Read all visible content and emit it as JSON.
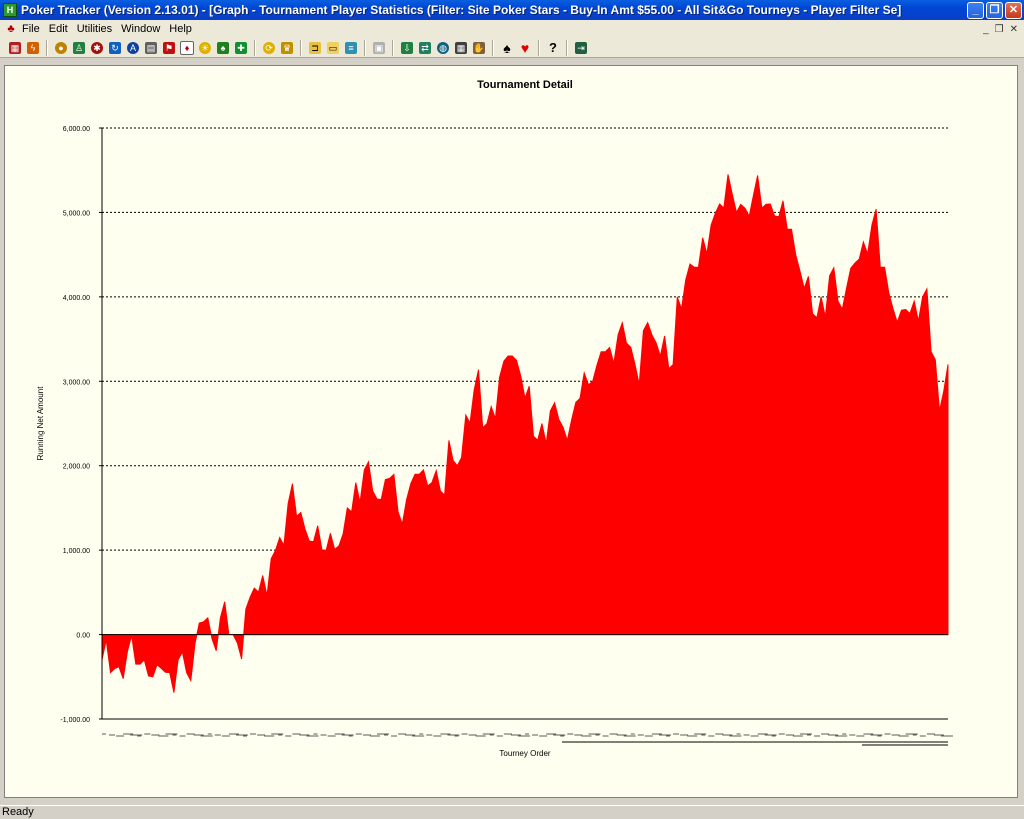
{
  "window": {
    "title": "Poker Tracker (Version 2.13.01) - [Graph - Tournament Player Statistics (Filter: Site Poker Stars - Buy-In Amt $55.00 - All Sit&Go Tourneys - Player Filter Se]"
  },
  "menu": {
    "items": [
      {
        "label": "File"
      },
      {
        "label": "Edit"
      },
      {
        "label": "Utilities"
      },
      {
        "label": "Window"
      },
      {
        "label": "Help"
      }
    ]
  },
  "toolbar": {
    "icons": [
      "graph-icon",
      "lightning-icon",
      "chip-icon",
      "player-icon",
      "gear-red-icon",
      "recycle-icon",
      "blue-a-icon",
      "stats-icon",
      "flag-icon",
      "card-icon",
      "sun-chip-icon",
      "spade-chip-icon",
      "green-chip-icon",
      "refresh-icon",
      "trophy-icon",
      "open-folder-icon",
      "folder-icon",
      "stack-icon",
      "save-icon",
      "import-icon",
      "sync-icon",
      "globe-icon",
      "grid-icon",
      "hand-icon",
      "spade-icon",
      "heart-icon",
      "help-icon",
      "exit-icon"
    ]
  },
  "status": {
    "text": "Ready"
  },
  "chart_data": {
    "type": "area",
    "title": "Tournament Detail",
    "xlabel": "Tourney Order",
    "ylabel": "Running Net Amount",
    "ylim": [
      -1000,
      6000
    ],
    "yticks": [
      "-1,000.00",
      "0.00",
      "1,000.00",
      "2,000.00",
      "3,000.00",
      "4,000.00",
      "5,000.00",
      "6,000.00"
    ],
    "grid": true,
    "fill_color": "#ff0000",
    "series": [
      {
        "x": [
          0,
          5,
          10,
          15,
          20,
          25,
          30,
          35,
          40,
          45,
          50,
          55,
          60,
          65,
          70,
          75,
          80,
          85,
          90,
          95,
          100,
          105,
          110,
          115,
          120,
          125,
          130,
          135,
          140,
          145,
          150,
          155,
          160,
          165,
          170,
          175,
          180,
          185,
          190,
          195,
          200,
          205,
          210,
          215,
          220,
          225,
          230,
          235,
          240,
          245,
          250,
          255,
          260,
          265,
          270,
          275,
          280,
          285,
          290,
          295,
          300,
          305,
          310,
          315,
          320,
          325,
          330,
          335,
          340,
          345,
          350,
          355,
          360,
          365,
          370,
          375,
          380,
          385,
          390,
          395,
          400,
          405,
          410,
          415,
          420,
          425,
          430,
          435,
          440,
          445,
          450,
          455,
          460,
          465,
          470,
          475,
          480,
          485,
          490,
          495,
          500
        ],
        "values": [
          -300,
          -450,
          -380,
          -200,
          -350,
          -300,
          -500,
          -400,
          -450,
          -300,
          -450,
          -100,
          150,
          -50,
          200,
          0,
          -100,
          300,
          550,
          700,
          900,
          1150,
          1550,
          1400,
          1250,
          1100,
          1000,
          1200,
          1050,
          1500,
          1800,
          1950,
          1700,
          1600,
          1850,
          1450,
          1600,
          1900,
          1950,
          1800,
          1700,
          2300,
          2000,
          2600,
          2900,
          2450,
          2700,
          3050,
          3300,
          3250,
          2800,
          2350,
          2500,
          2650,
          2550,
          2300,
          2750,
          3100,
          3000,
          3350,
          3400,
          3550,
          3450,
          3200,
          3600,
          3550,
          3300,
          3150,
          4000,
          4200,
          4350,
          4700,
          4850,
          5100,
          5450,
          5000,
          5050,
          5200,
          5050,
          5100,
          4950,
          4800,
          4500,
          4100,
          3800,
          4000,
          4250,
          3950,
          4100,
          4400,
          4650,
          4850,
          4350,
          4050,
          3700,
          3850,
          3950,
          4000,
          3350,
          2650,
          3200
        ]
      }
    ]
  }
}
